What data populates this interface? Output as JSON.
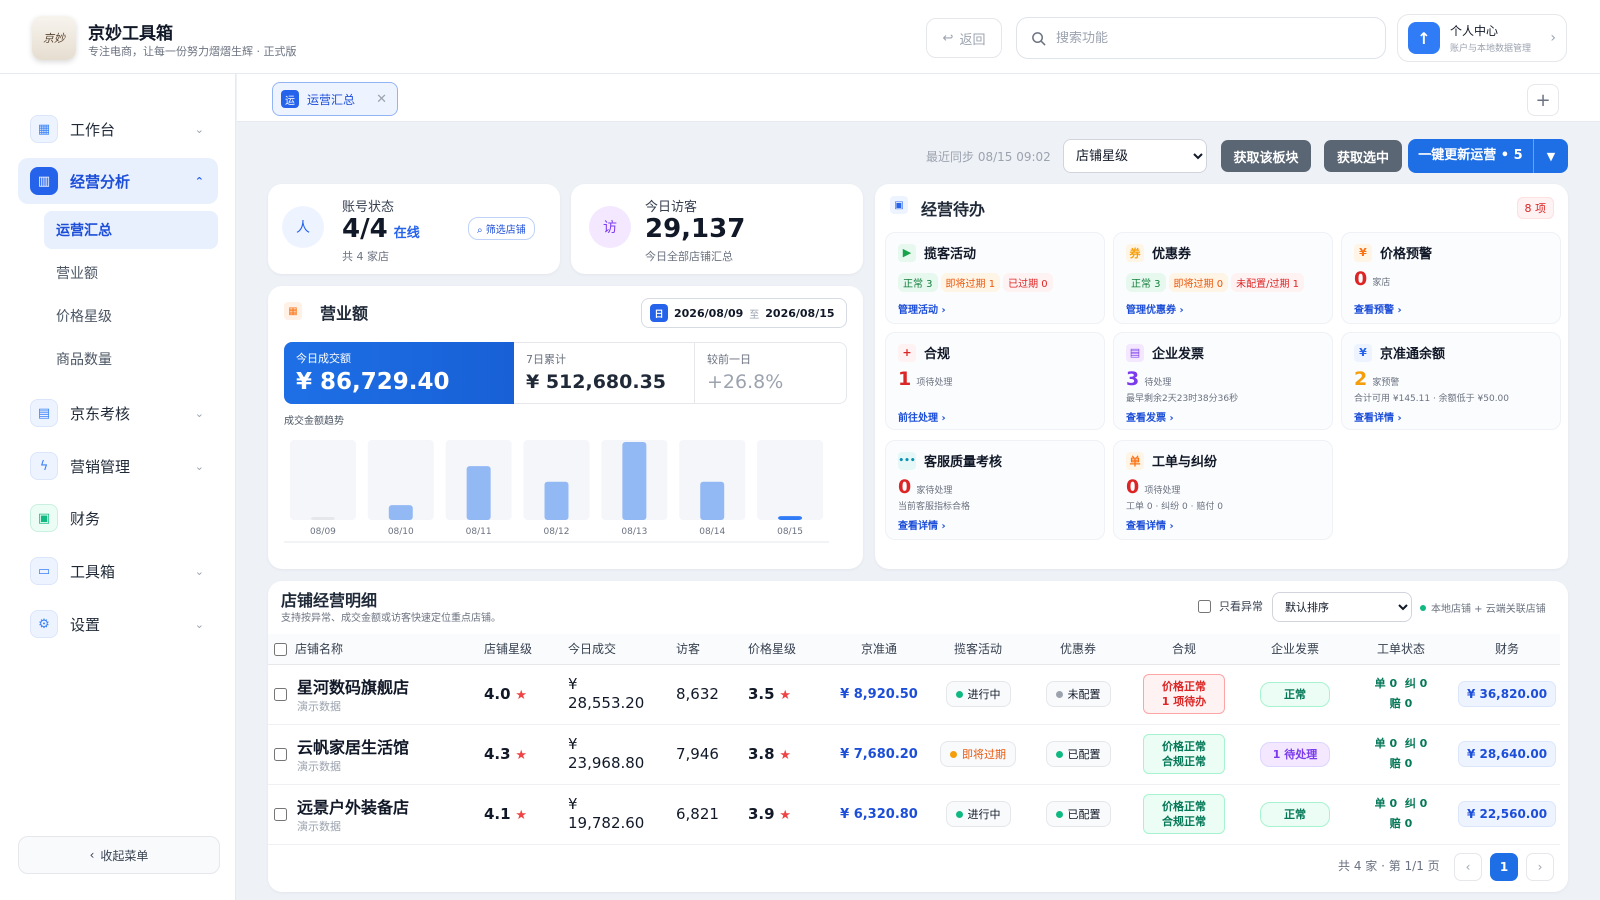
{
  "app": {
    "title": "京妙工具箱",
    "subtitle": "专注电商，让每一份努力熠熠生辉 · 正式版",
    "logo_text": "京妙"
  },
  "header": {
    "back_label": "返回",
    "search_placeholder": "搜索功能",
    "profile_title": "个人中心",
    "profile_sub": "账户与本地数据管理"
  },
  "sidebar": {
    "items": [
      {
        "label": "工作台",
        "icon": "grid-icon"
      },
      {
        "label": "经营分析",
        "icon": "chart-icon"
      },
      {
        "label": "京东考核",
        "icon": "clipboard-icon"
      },
      {
        "label": "营销管理",
        "icon": "bolt-icon"
      },
      {
        "label": "财务",
        "icon": "wallet-icon"
      },
      {
        "label": "工具箱",
        "icon": "toolbox-icon"
      },
      {
        "label": "设置",
        "icon": "gear-icon"
      }
    ],
    "subitems": [
      "运营汇总",
      "营业额",
      "价格星级",
      "商品数量"
    ],
    "collapse_label": "收起菜单"
  },
  "tabs": [
    {
      "label": "运营汇总",
      "icon_text": "运"
    }
  ],
  "toolbar": {
    "sync": "最近同步 08/15 09:02",
    "select_value": "店铺星级",
    "btn_fetch_block": "获取该板块",
    "btn_fetch_selected": "获取选中",
    "btn_update": "一键更新运营 • 5"
  },
  "kpi": {
    "account": {
      "label": "账号状态",
      "value": "4/4",
      "status": "在线",
      "sub": "共 4 家店",
      "icon_text": "人",
      "filter_label": "筛选店铺"
    },
    "visitors": {
      "label": "今日访客",
      "value": "29,137",
      "sub": "今日全部店铺汇总",
      "icon_text": "访"
    }
  },
  "revenue": {
    "title": "营业额",
    "date_from": "2026/08/09",
    "date_sep": "至",
    "date_to": "2026/08/15",
    "today_label": "今日成交额",
    "today_value": "¥ 86,729.40",
    "week_label": "7日累计",
    "week_value": "¥ 512,680.35",
    "delta_label": "较前一日",
    "delta_value": "+26.8%",
    "trend_label": "成交金额趋势"
  },
  "chart_data": {
    "type": "bar",
    "categories": [
      "08/09",
      "08/10",
      "08/11",
      "08/12",
      "08/13",
      "08/14",
      "08/15"
    ],
    "values": [
      3,
      19,
      69,
      49,
      100,
      49,
      5
    ],
    "ylim": [
      0,
      100
    ],
    "grid": false,
    "colors": [
      "#e5e7eb",
      "#93b9f5",
      "#93b9f5",
      "#93b9f5",
      "#93b9f5",
      "#93b9f5",
      "#2f7cf6"
    ]
  },
  "todo": {
    "title": "经营待办",
    "count_badge": "8 项",
    "cards": [
      {
        "title": "揽客活动",
        "icon_text": "▶",
        "chips": [
          "正常 3",
          "即将过期 1",
          "已过期 0"
        ],
        "link": "管理活动 ›"
      },
      {
        "title": "优惠券",
        "icon_text": "券",
        "chips": [
          "正常 3",
          "即将过期 0",
          "未配置/过期 1"
        ],
        "link": "管理优惠券 ›"
      },
      {
        "title": "价格预警",
        "icon_text": "¥",
        "num": "0",
        "unit": "家店",
        "link": "查看预警 ›"
      },
      {
        "title": "合规",
        "icon_text": "+",
        "num": "1",
        "unit": "项待处理",
        "link": "前往处理 ›"
      },
      {
        "title": "企业发票",
        "icon_text": "▤",
        "num": "3",
        "unit": "待处理",
        "note": "最早剩余2天23时38分36秒",
        "link": "查看发票 ›"
      },
      {
        "title": "京准通余额",
        "icon_text": "¥",
        "num": "2",
        "unit": "家预警",
        "note": "合计可用 ¥145.11 · 余额低于 ¥50.00",
        "link": "查看详情 ›"
      },
      {
        "title": "客服质量考核",
        "icon_text": "•••",
        "num": "0",
        "unit": "家待处理",
        "note": "当前客服指标合格",
        "link": "查看详情 ›"
      },
      {
        "title": "工单与纠纷",
        "icon_text": "单",
        "num": "0",
        "unit": "项待处理",
        "note": "工单 0 · 纠纷 0 · 赔付 0",
        "link": "查看详情 ›"
      }
    ]
  },
  "stores": {
    "title": "店铺经营明细",
    "subtitle": "支持按异常、成交金额或访客快速定位重点店铺。",
    "only_abnormal": "只看异常",
    "sort_value": "默认排序",
    "legend": "本地店铺 + 云端关联店铺",
    "columns": [
      "店铺名称",
      "店铺星级",
      "今日成交",
      "访客",
      "价格星级",
      "京准通",
      "揽客活动",
      "优惠券",
      "合规",
      "企业发票",
      "工单状态",
      "财务"
    ],
    "rows": [
      {
        "name": "星河数码旗舰店",
        "tag": "演示数据",
        "star": "4.0",
        "sales_sym": "¥",
        "sales": "28,553.20",
        "visitors": "8,632",
        "price_star": "3.5",
        "jzt": "¥ 8,920.50",
        "activity": "进行中",
        "coupon": "未配置",
        "compliance_1": "价格正常",
        "compliance_2": "1 项待办",
        "invoice": "正常",
        "t_dan": "单 0",
        "t_jiu": "纠 0",
        "t_pei": "赔 0",
        "finance": "¥ 36,820.00"
      },
      {
        "name": "云帆家居生活馆",
        "tag": "演示数据",
        "star": "4.3",
        "sales_sym": "¥",
        "sales": "23,968.80",
        "visitors": "7,946",
        "price_star": "3.8",
        "jzt": "¥ 7,680.20",
        "activity": "即将过期",
        "coupon": "已配置",
        "compliance_1": "价格正常",
        "compliance_2": "合规正常",
        "invoice": "1 待处理",
        "t_dan": "单 0",
        "t_jiu": "纠 0",
        "t_pei": "赔 0",
        "finance": "¥ 28,640.00"
      },
      {
        "name": "远景户外装备店",
        "tag": "演示数据",
        "star": "4.1",
        "sales_sym": "¥",
        "sales": "19,782.60",
        "visitors": "6,821",
        "price_star": "3.9",
        "jzt": "¥ 6,320.80",
        "activity": "进行中",
        "coupon": "已配置",
        "compliance_1": "价格正常",
        "compliance_2": "合规正常",
        "invoice": "正常",
        "t_dan": "单 0",
        "t_jiu": "纠 0",
        "t_pei": "赔 0",
        "finance": "¥ 22,560.00"
      }
    ],
    "pagination": {
      "summary": "共 4 家 · 第 1/1 页",
      "prev": "‹",
      "current": "1",
      "next": "›"
    }
  }
}
